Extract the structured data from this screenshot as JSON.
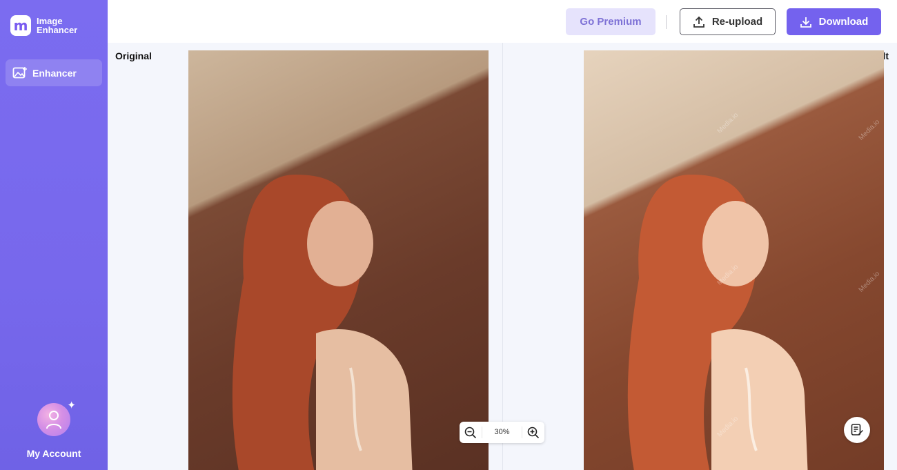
{
  "brand": {
    "logo_glyph": "m",
    "line1": "Image",
    "line2": "Enhancer"
  },
  "sidebar": {
    "items": [
      {
        "label": "Enhancer",
        "icon": "image-enhance-icon",
        "active": true
      }
    ]
  },
  "account": {
    "label": "My Account"
  },
  "toolbar": {
    "premium_label": "Go Premium",
    "reupload_label": "Re-upload",
    "download_label": "Download"
  },
  "panes": {
    "original_label": "Original",
    "result_label": "Result"
  },
  "zoom": {
    "value": "30%"
  },
  "watermark": {
    "text": "Media.io"
  },
  "colors": {
    "accent": "#7462ee",
    "sidebar": "#7b6cf0",
    "premium_bg": "#e6e3fc"
  }
}
